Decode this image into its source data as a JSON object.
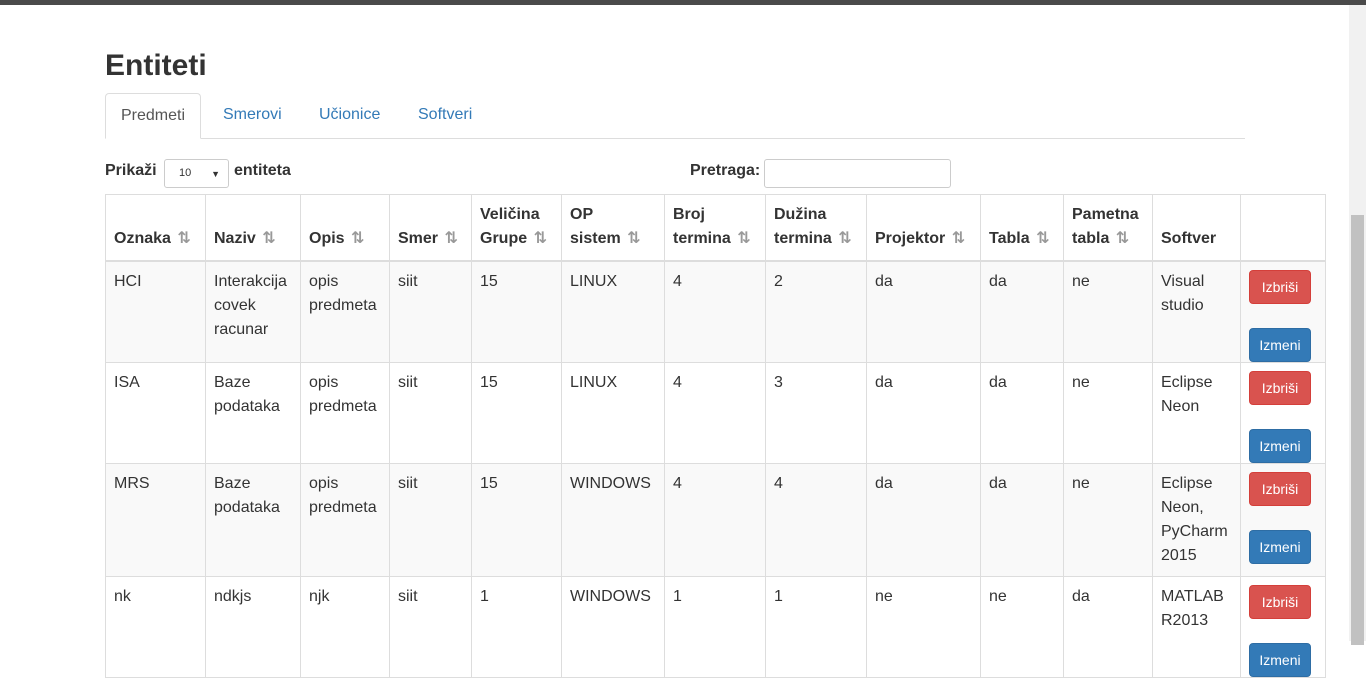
{
  "page_title": "Entiteti",
  "tabs": [
    {
      "label": "Predmeti",
      "active": true
    },
    {
      "label": "Smerovi",
      "active": false
    },
    {
      "label": "Učionice",
      "active": false
    },
    {
      "label": "Softveri",
      "active": false
    }
  ],
  "controls": {
    "show_label": "Prikaži",
    "page_size": "10",
    "entities_label": "entiteta",
    "search_label": "Pretraga:",
    "search_value": ""
  },
  "table": {
    "columns": [
      {
        "line1": "",
        "line2": "Oznaka",
        "sortable": true
      },
      {
        "line1": "",
        "line2": "Naziv",
        "sortable": true
      },
      {
        "line1": "",
        "line2": "Opis",
        "sortable": true
      },
      {
        "line1": "",
        "line2": "Smer",
        "sortable": true
      },
      {
        "line1": "Veličina",
        "line2": "Grupe",
        "sortable": true
      },
      {
        "line1": "OP",
        "line2": "sistem",
        "sortable": true
      },
      {
        "line1": "Broj",
        "line2": "termina",
        "sortable": true
      },
      {
        "line1": "Dužina",
        "line2": "termina",
        "sortable": true
      },
      {
        "line1": "",
        "line2": "Projektor",
        "sortable": true
      },
      {
        "line1": "",
        "line2": "Tabla",
        "sortable": true
      },
      {
        "line1": "Pametna",
        "line2": "tabla",
        "sortable": true
      },
      {
        "line1": "",
        "line2": "Softver",
        "sortable": false
      },
      {
        "line1": "",
        "line2": "",
        "sortable": false
      }
    ],
    "rows": [
      {
        "cells": [
          "HCI",
          "Interakcija covek racunar",
          "opis predmeta",
          "siit",
          "15",
          "LINUX",
          "4",
          "2",
          "da",
          "da",
          "ne",
          "Visual studio"
        ]
      },
      {
        "cells": [
          "ISA",
          "Baze podataka",
          "opis predmeta",
          "siit",
          "15",
          "LINUX",
          "4",
          "3",
          "da",
          "da",
          "ne",
          "Eclipse Neon"
        ]
      },
      {
        "cells": [
          "MRS",
          "Baze podataka",
          "opis predmeta",
          "siit",
          "15",
          "WINDOWS",
          "4",
          "4",
          "da",
          "da",
          "ne",
          "Eclipse Neon, PyCharm 2015"
        ]
      },
      {
        "cells": [
          "nk",
          "ndkjs",
          "njk",
          "siit",
          "1",
          "WINDOWS",
          "1",
          "1",
          "ne",
          "ne",
          "da",
          "MATLAB R2013"
        ]
      }
    ],
    "delete_label": "Izbriši",
    "edit_label": "Izmeni",
    "sort_icon": "⇅"
  }
}
